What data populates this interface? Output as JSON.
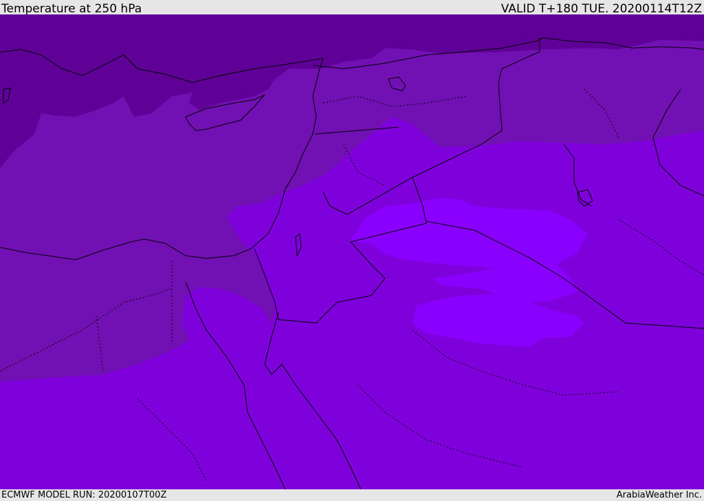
{
  "header": {
    "title": "Temperature at 250 hPa",
    "valid": "VALID T+180 TUE. 20200114T12Z"
  },
  "footer": {
    "model_run": "ECMWF MODEL RUN: 20200107T00Z",
    "credit": "ArabiaWeather Inc."
  },
  "map": {
    "colors": {
      "coldest": "#5f0096",
      "cold": "#7211b3",
      "mid": "#7e00da",
      "warm": "#8a00ff",
      "border": "#000000"
    }
  }
}
